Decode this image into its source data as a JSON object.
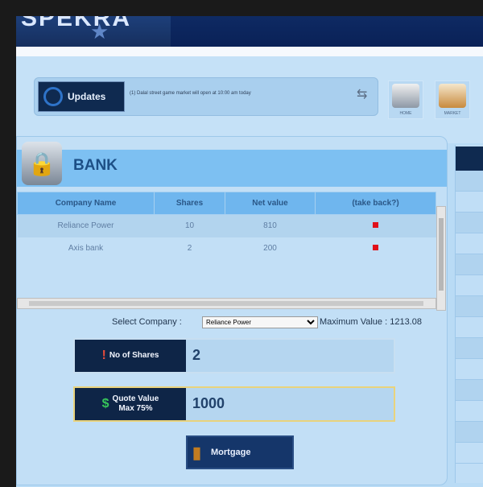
{
  "header": {
    "logo_text": "SPEKRA"
  },
  "updates": {
    "button_label": "Updates",
    "ticker": "(1) Dalal street game market will open at 10:00 am today"
  },
  "nav": [
    {
      "label": "HOME"
    },
    {
      "label": "MARKET"
    }
  ],
  "bank": {
    "title": "BANK",
    "columns": [
      "Company Name",
      "Shares",
      "Net value",
      "(take back?)"
    ],
    "rows": [
      {
        "company": "Reliance Power",
        "shares": "10",
        "net_value": "810"
      },
      {
        "company": "Axis bank",
        "shares": "2",
        "net_value": "200"
      }
    ],
    "select_label": "Select Company :",
    "select_value": "Reliance Power",
    "max_value": "Maximum Value : 1213.08",
    "shares_label": "No of Shares",
    "shares_value": "2",
    "quote_label_1": "Quote Value",
    "quote_label_2": "Max 75%",
    "quote_value": "1000",
    "mortgage_label": "Mortgage"
  },
  "colors": {
    "accent": "#0e2547",
    "remove": "#e0101a",
    "panel": "#c2dff6"
  }
}
